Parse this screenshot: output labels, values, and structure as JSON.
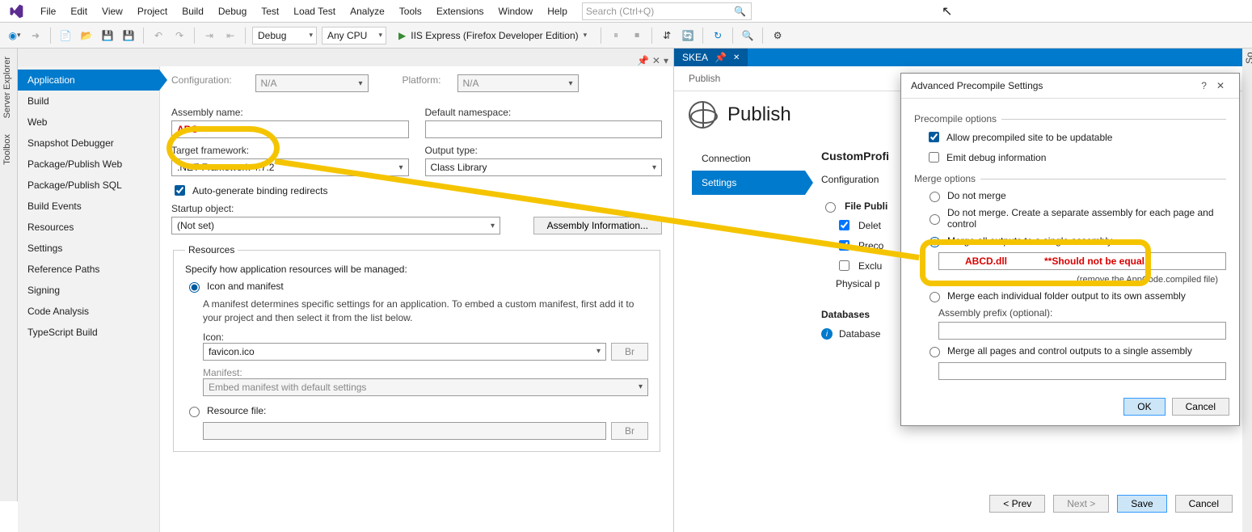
{
  "menubar": [
    "File",
    "Edit",
    "View",
    "Project",
    "Build",
    "Debug",
    "Test",
    "Load Test",
    "Analyze",
    "Tools",
    "Extensions",
    "Window",
    "Help"
  ],
  "search_placeholder": "Search (Ctrl+Q)",
  "toolbar": {
    "config": "Debug",
    "platform": "Any CPU",
    "run_label": "IIS Express (Firefox Developer Edition)"
  },
  "lefttools": [
    "Server Explorer",
    "Toolbox"
  ],
  "righttool": "So",
  "propnav": [
    "Application",
    "Build",
    "Web",
    "Snapshot Debugger",
    "Package/Publish Web",
    "Package/Publish SQL",
    "Build Events",
    "Resources",
    "Settings",
    "Reference Paths",
    "Signing",
    "Code Analysis",
    "TypeScript Build"
  ],
  "prop": {
    "config_label": "Configuration:",
    "config_value": "N/A",
    "platform_label": "Platform:",
    "platform_value": "N/A",
    "assembly_name_label": "Assembly name:",
    "assembly_name_value": "ABC",
    "default_ns_label": "Default namespace:",
    "default_ns_value": "",
    "target_fw_label": "Target framework:",
    "target_fw_value": ".NET Framework 4.7.2",
    "output_type_label": "Output type:",
    "output_type_value": "Class Library",
    "autogen_label": "Auto-generate binding redirects",
    "startup_label": "Startup object:",
    "startup_value": "(Not set)",
    "asm_info_btn": "Assembly Information...",
    "resources_legend": "Resources",
    "resources_help": "Specify how application resources will be managed:",
    "icon_manifest_label": "Icon and manifest",
    "icon_manifest_help": "A manifest determines specific settings for an application. To embed a custom manifest, first add it to your project and then select it from the list below.",
    "icon_label": "Icon:",
    "icon_value": "favicon.ico",
    "browse_btn": "Br",
    "manifest_label": "Manifest:",
    "manifest_value": "Embed manifest with default settings",
    "resource_file_label": "Resource file:"
  },
  "pub": {
    "tab_name": "SKEA",
    "crumb": "Publish",
    "title": "Publish",
    "nav": [
      "Connection",
      "Settings"
    ],
    "profile_label": "CustomProfi",
    "config_label": "Configuration",
    "file_pub_label": "File Publi",
    "delete_label": "Delet",
    "preco_label": "Preco",
    "exclu_label": "Exclu",
    "physical_label": "Physical p",
    "db_heading": "Databases",
    "db_label": "Database",
    "prev_btn": "< Prev",
    "next_btn": "Next >",
    "save_btn": "Save",
    "cancel_btn": "Cancel"
  },
  "dlg": {
    "title": "Advanced Precompile Settings",
    "precompile_group": "Precompile options",
    "allow_updatable": "Allow precompiled site to be updatable",
    "emit_debug": "Emit debug information",
    "merge_group": "Merge options",
    "r1": "Do not merge",
    "r2": "Do not merge. Create a separate assembly for each page and control",
    "r3": "Merge all outputs to a single assembly",
    "merge_value": "ABCD.dll",
    "merge_note": "**Should not be equal.",
    "treat_note": "(remove the AppCode.compiled file)",
    "r4": "Merge each individual folder output to its own assembly",
    "prefix_label": "Assembly prefix (optional):",
    "r5": "Merge all pages and control outputs to a single assembly",
    "ok": "OK",
    "cancel": "Cancel"
  }
}
